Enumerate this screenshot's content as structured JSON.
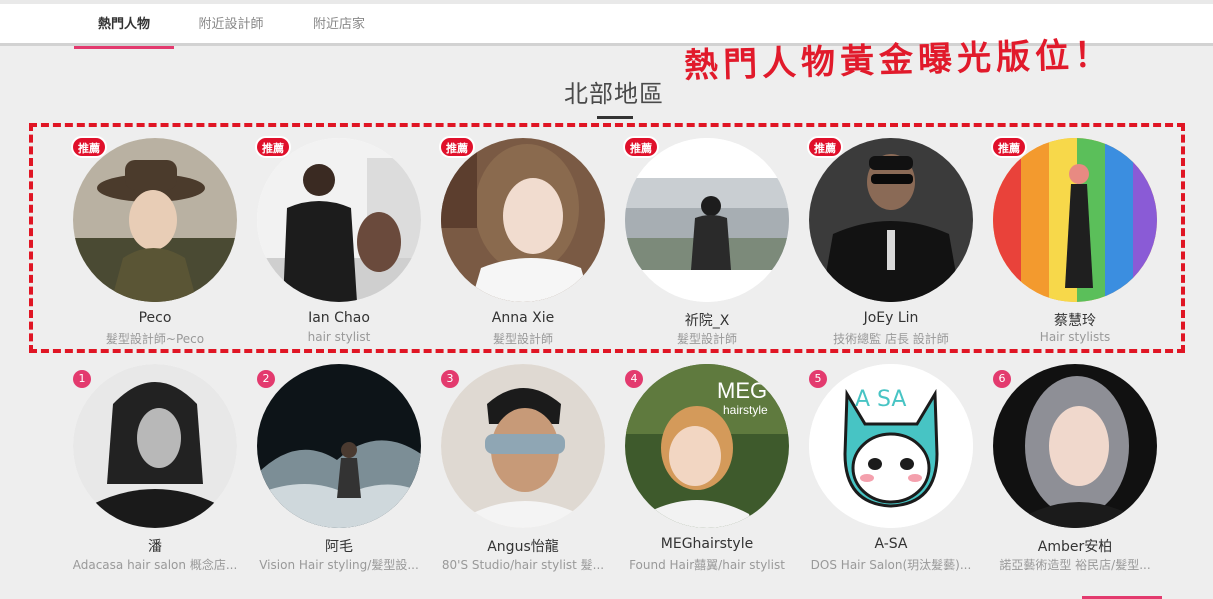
{
  "tabs": [
    {
      "label": "熱門人物",
      "active": true
    },
    {
      "label": "附近設計師",
      "active": false
    },
    {
      "label": "附近店家",
      "active": false
    }
  ],
  "promo_text": "熱門人物黃金曝光版位！",
  "region_title": "北部地區",
  "recommended_badge": "推薦",
  "featured": [
    {
      "name": "Peco",
      "subtitle": "髮型設計師~Peco"
    },
    {
      "name": "Ian Chao",
      "subtitle": "hair stylist"
    },
    {
      "name": "Anna Xie",
      "subtitle": "髮型設計師"
    },
    {
      "name": "祈院_X",
      "subtitle": "髮型設計師"
    },
    {
      "name": "JoEy Lin",
      "subtitle": "技術總監 店長 設計師"
    },
    {
      "name": "蔡慧玲",
      "subtitle": "Hair stylists"
    }
  ],
  "ranked": [
    {
      "rank": "1",
      "name": "潘",
      "subtitle": "Adacasa hair salon 概念店..."
    },
    {
      "rank": "2",
      "name": "阿毛",
      "subtitle": "Vision Hair styling/髮型設..."
    },
    {
      "rank": "3",
      "name": "Angus怡龍",
      "subtitle": "80'S Studio/hair stylist 髮..."
    },
    {
      "rank": "4",
      "name": "MEGhairstyle",
      "subtitle": "Found Hair囍翼/hair stylist"
    },
    {
      "rank": "5",
      "name": "A-SA",
      "subtitle": "DOS Hair Salon(玥汰髮藝)..."
    },
    {
      "rank": "6",
      "name": "Amber安柏",
      "subtitle": "諾亞藝術造型 裕民店/髮型..."
    }
  ],
  "avatar_art": {
    "meg_logo_text": "MEG",
    "meg_logo_sub": "hairstyle",
    "asa_text": "A SA"
  },
  "colors": {
    "accent": "#e33a6e",
    "badge_red": "#e0102b",
    "promo_red": "#e11a2b"
  }
}
